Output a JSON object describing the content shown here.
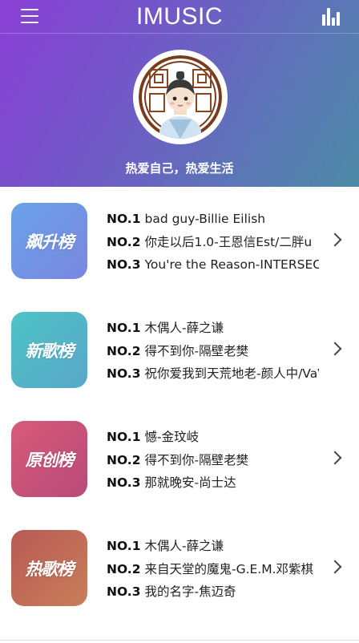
{
  "app": {
    "title": "IMUSIC",
    "slogan": "热爱自己，热爱生活"
  },
  "icons": {
    "menu": "hamburger-menu-icon",
    "right": "bar-chart-icon",
    "chevron": "chevron-right-icon"
  },
  "colors": {
    "header_gradient": [
      "#8a3fd6",
      "#4c8aa6"
    ]
  },
  "charts": [
    {
      "label": "飙升榜",
      "cover_gradient": [
        "#6aa2e8",
        "#7a86e0"
      ],
      "tracks": [
        {
          "rank": "NO.1",
          "title": "bad guy-Billie Eilish"
        },
        {
          "rank": "NO.2",
          "title": "你走以后1.0-王恩信Est/二胖u"
        },
        {
          "rank": "NO.3",
          "title": "You're the Reason-INTERSECTION"
        }
      ]
    },
    {
      "label": "新歌榜",
      "cover_gradient": [
        "#4cc3c6",
        "#5aa7c9"
      ],
      "tracks": [
        {
          "rank": "NO.1",
          "title": "木偶人-薛之谦"
        },
        {
          "rank": "NO.2",
          "title": "得不到你-隔壁老樊"
        },
        {
          "rank": "NO.3",
          "title": "祝你爱我到天荒地老-颜人中/VaVa"
        }
      ]
    },
    {
      "label": "原创榜",
      "cover_gradient": [
        "#d85a7a",
        "#b84a78"
      ],
      "tracks": [
        {
          "rank": "NO.1",
          "title": "憾-金玟岐"
        },
        {
          "rank": "NO.2",
          "title": "得不到你-隔壁老樊"
        },
        {
          "rank": "NO.3",
          "title": "那就晚安-尚士达"
        }
      ]
    },
    {
      "label": "热歌榜",
      "cover_gradient": [
        "#b85a56",
        "#c97e58"
      ],
      "tracks": [
        {
          "rank": "NO.1",
          "title": "木偶人-薛之谦"
        },
        {
          "rank": "NO.2",
          "title": "来自天堂的魔鬼-G.E.M.邓紫棋"
        },
        {
          "rank": "NO.3",
          "title": "我的名字-焦迈奇"
        }
      ]
    }
  ]
}
